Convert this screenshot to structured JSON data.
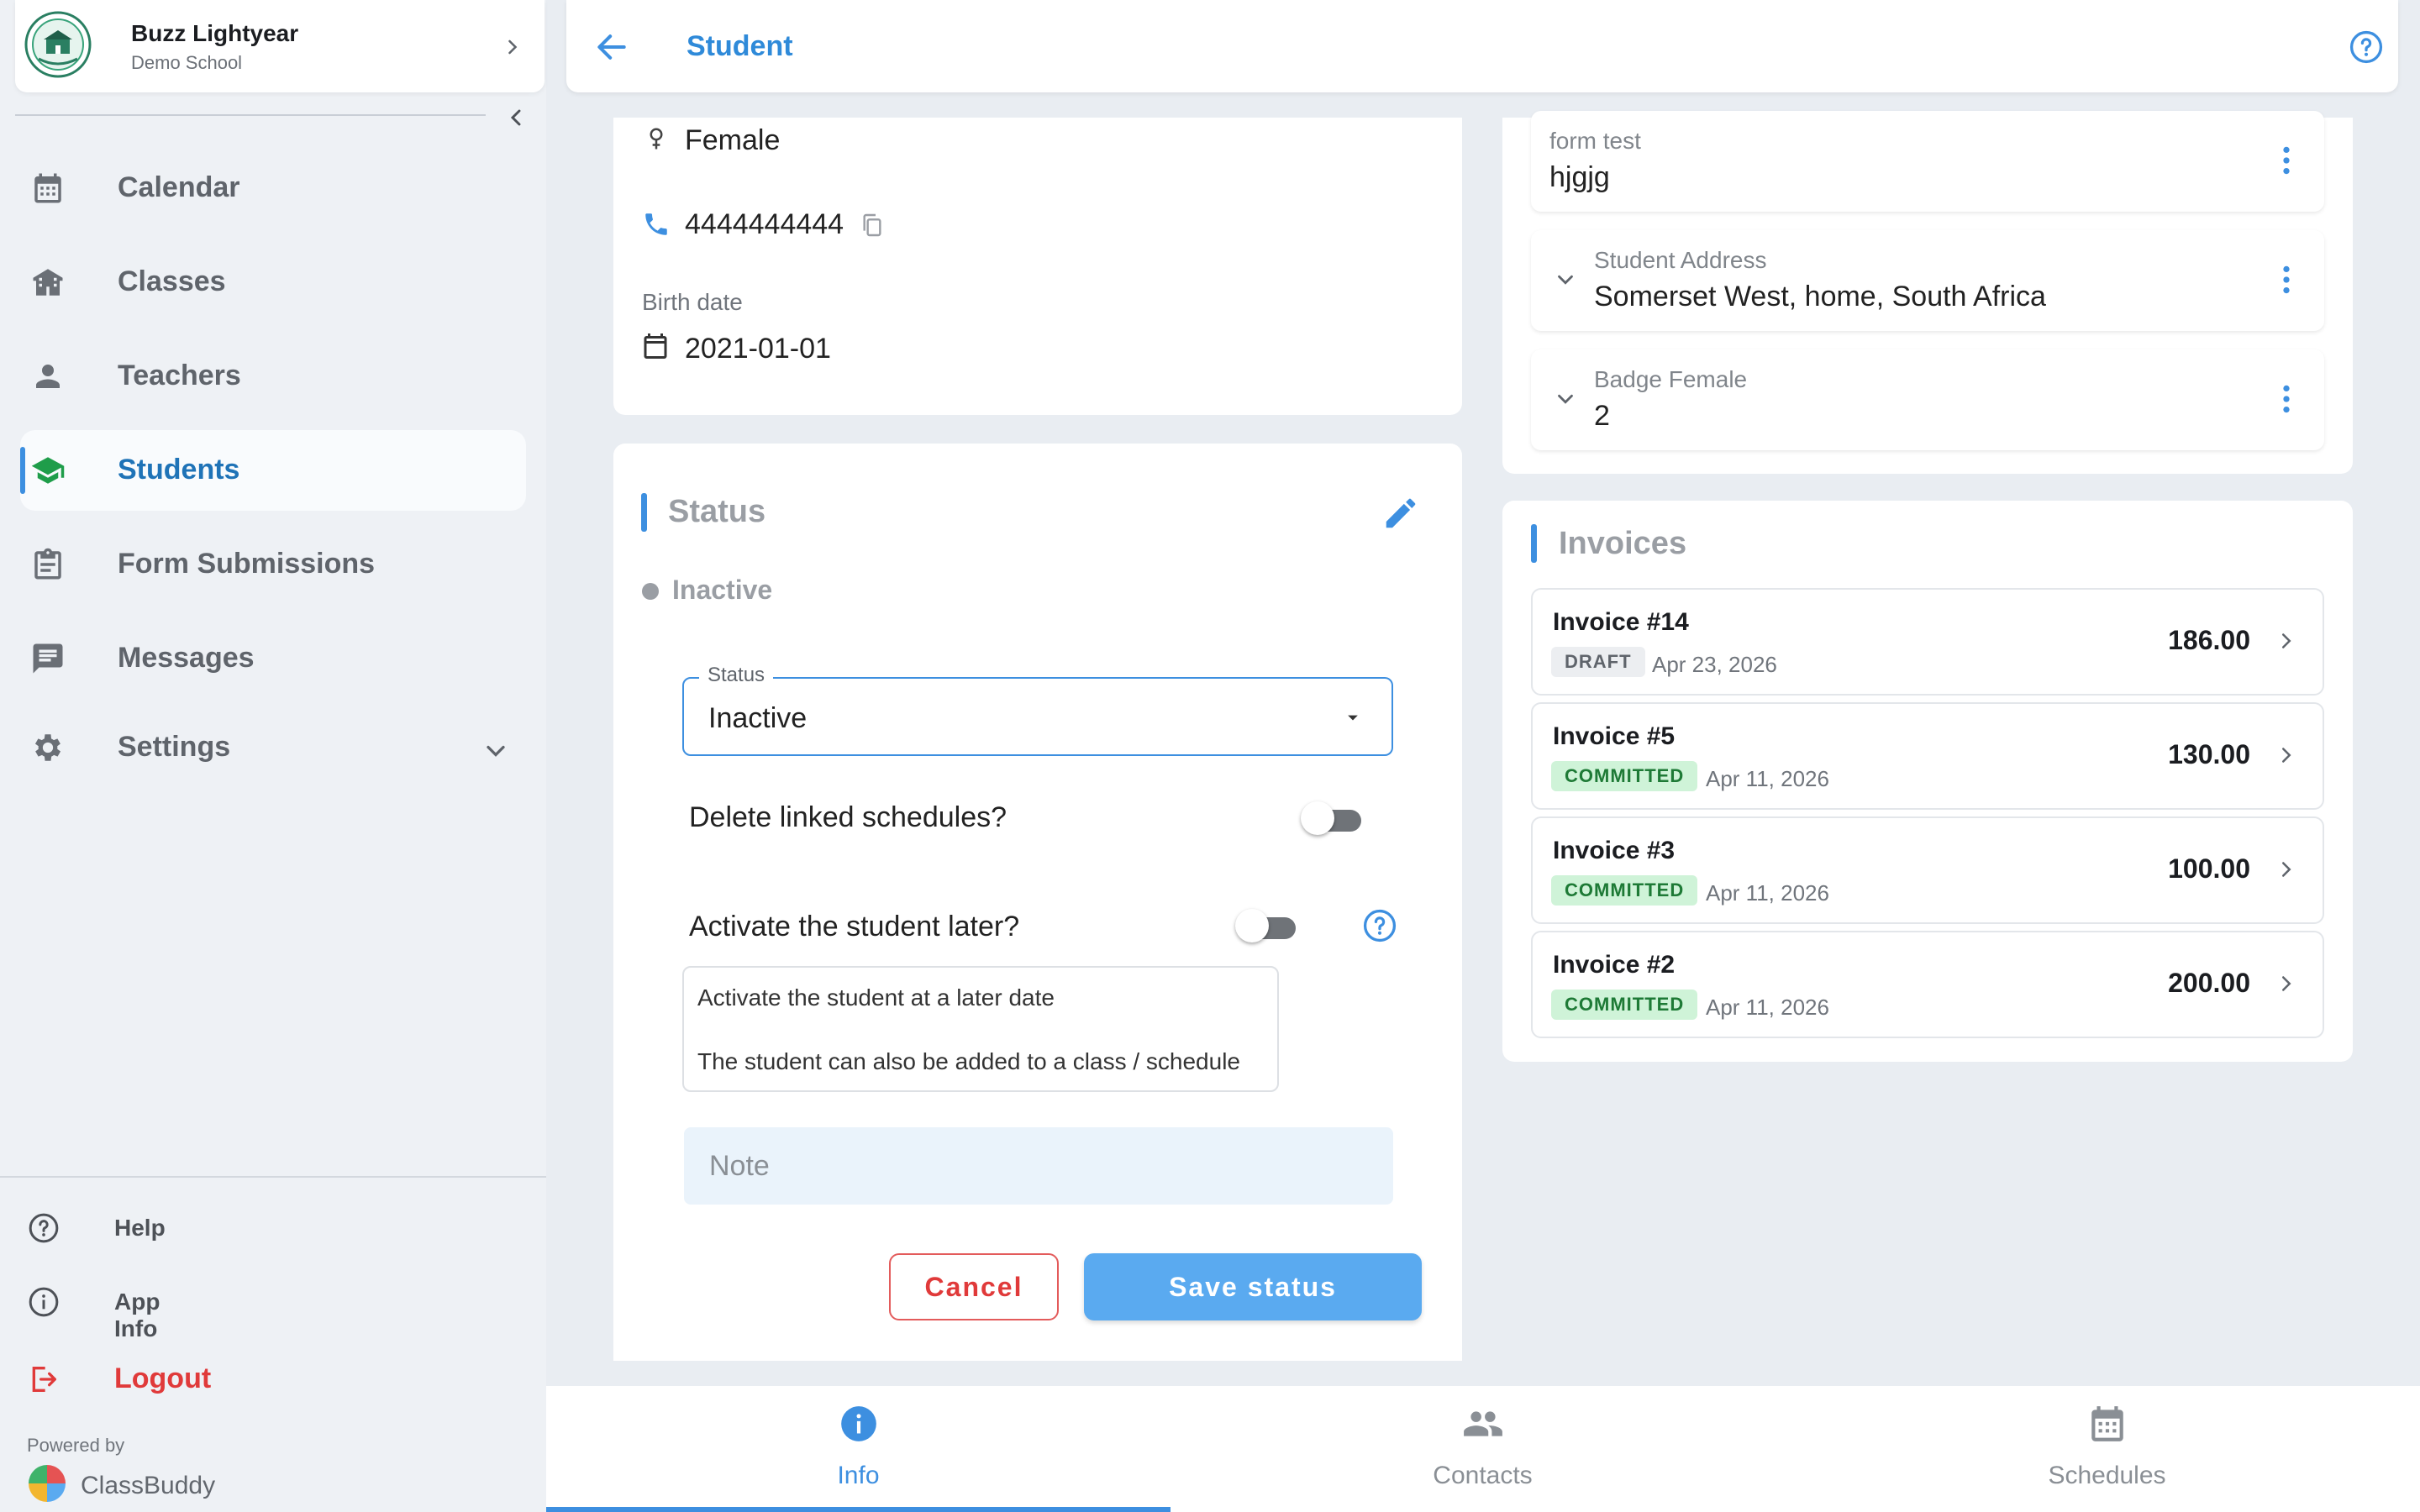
{
  "profile": {
    "name": "Buzz Lightyear",
    "school": "Demo School"
  },
  "nav": {
    "items": [
      {
        "label": "Calendar",
        "icon": "calendar-icon"
      },
      {
        "label": "Classes",
        "icon": "classes-icon"
      },
      {
        "label": "Teachers",
        "icon": "teacher-icon"
      },
      {
        "label": "Students",
        "icon": "graduation-cap-icon",
        "active": true
      },
      {
        "label": "Form Submissions",
        "icon": "clipboard-icon"
      },
      {
        "label": "Messages",
        "icon": "message-icon"
      },
      {
        "label": "Settings",
        "icon": "gear-icon"
      }
    ],
    "footer": {
      "help": "Help",
      "app_info": "App Info",
      "logout": "Logout"
    },
    "powered_by": "Powered by",
    "brand": "ClassBuddy"
  },
  "header": {
    "title": "Student"
  },
  "info": {
    "gender": "Female",
    "phone": "4444444444",
    "birth_label": "Birth date",
    "birth_date": "2021-01-01"
  },
  "status": {
    "title": "Status",
    "current": "Inactive",
    "select_label": "Status",
    "select_value": "Inactive",
    "delete_schedules_label": "Delete linked schedules?",
    "delete_schedules_on": false,
    "activate_later_label": "Activate the student later?",
    "activate_later_on": false,
    "info_line1": "Activate the student at a later date",
    "info_line2": "The student can also be added to a class / schedule",
    "note_placeholder": "Note",
    "cancel_label": "Cancel",
    "save_label": "Save status"
  },
  "fields": [
    {
      "label": "form test",
      "value": "hjgjg"
    },
    {
      "label": "Student Address",
      "value": "Somerset West, home, South Africa"
    },
    {
      "label": "Badge Female",
      "value": "2"
    }
  ],
  "invoices": {
    "title": "Invoices",
    "items": [
      {
        "title": "Invoice #14",
        "status": "DRAFT",
        "date": "Apr 23, 2026",
        "amount": "186.00"
      },
      {
        "title": "Invoice #5",
        "status": "COMMITTED",
        "date": "Apr 11, 2026",
        "amount": "130.00"
      },
      {
        "title": "Invoice #3",
        "status": "COMMITTED",
        "date": "Apr 11, 2026",
        "amount": "100.00"
      },
      {
        "title": "Invoice #2",
        "status": "COMMITTED",
        "date": "Apr 11, 2026",
        "amount": "200.00"
      }
    ]
  },
  "tabs": [
    {
      "label": "Info",
      "icon": "info-icon",
      "active": true
    },
    {
      "label": "Contacts",
      "icon": "contacts-icon"
    },
    {
      "label": "Schedules",
      "icon": "calendar-icon"
    }
  ],
  "colors": {
    "accent": "#3d8fe0",
    "danger": "#e03a3a",
    "committed_bg": "#cff3d8",
    "draft_bg": "#eceef1"
  }
}
